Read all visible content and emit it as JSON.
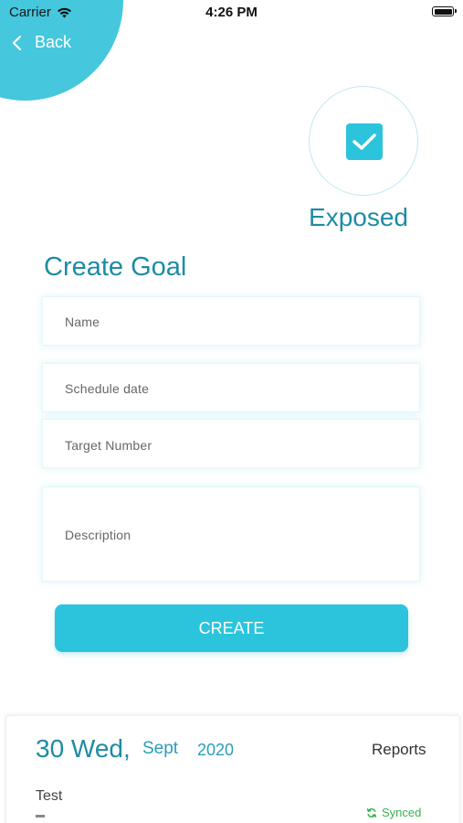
{
  "status_bar": {
    "carrier": "Carrier",
    "time": "4:26 PM",
    "wifi_icon": "wifi-icon",
    "battery_icon": "battery-icon"
  },
  "nav": {
    "back_label": "Back",
    "back_icon": "chevron-left-icon"
  },
  "exposed": {
    "label": "Exposed",
    "checked": true,
    "icon": "checkbox-checked-icon"
  },
  "form": {
    "title": "Create Goal",
    "name_placeholder": "Name",
    "schedule_placeholder": "Schedule date",
    "target_placeholder": "Target Number",
    "description_placeholder": "Description",
    "submit_label": "CREATE"
  },
  "entry": {
    "day": "30 Wed,",
    "month": "Sept",
    "year": "2020",
    "reports_label": "Reports",
    "title": "Test",
    "status": "Synced",
    "status_icon": "sync-icon"
  },
  "colors": {
    "accent": "#2bc4dc",
    "heading": "#1d8ca5",
    "synced": "#37b24d"
  }
}
